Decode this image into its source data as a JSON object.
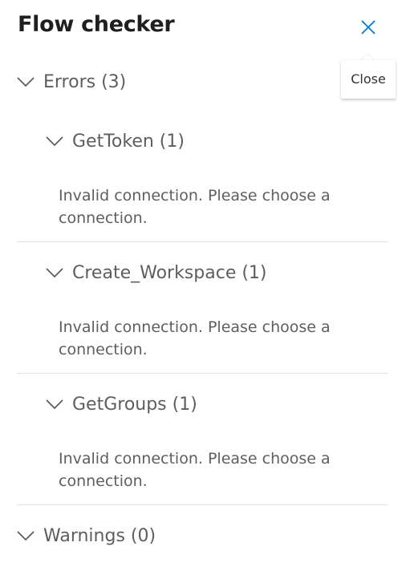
{
  "panel": {
    "title": "Flow checker",
    "close_tooltip": "Close"
  },
  "errors": {
    "label": "Errors (3)",
    "groups": [
      {
        "label": "GetToken (1)",
        "message": "Invalid connection. Please choose a connection."
      },
      {
        "label": "Create_Workspace (1)",
        "message": "Invalid connection. Please choose a connection."
      },
      {
        "label": "GetGroups (1)",
        "message": "Invalid connection. Please choose a connection."
      }
    ]
  },
  "warnings": {
    "label": "Warnings (0)"
  },
  "colors": {
    "accent": "#0078d4",
    "text_primary": "#201f1e",
    "text_secondary": "#605e5c",
    "divider": "#e1dfdd"
  },
  "icons": {
    "close": "close-icon",
    "chevron": "chevron-down-icon"
  }
}
